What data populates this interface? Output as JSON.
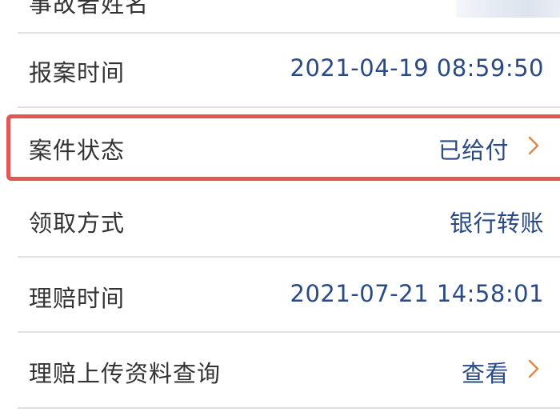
{
  "rows": [
    {
      "label": "事故者姓名",
      "value": ""
    },
    {
      "label": "报案时间",
      "value": "2021-04-19 08:59:50"
    },
    {
      "label": "案件状态",
      "value": "已给付"
    },
    {
      "label": "领取方式",
      "value": "银行转账"
    },
    {
      "label": "理赔时间",
      "value": "2021-07-21 14:58:01"
    },
    {
      "label": "理赔上传资料查询",
      "value": "查看"
    }
  ],
  "colors": {
    "label": "#333333",
    "value": "#2a4a86",
    "chevron": "#e08a4a",
    "highlight": "#e05757",
    "divider": "#e1e1e1"
  },
  "icons": {
    "row_chevron": "chevron-right-icon"
  }
}
